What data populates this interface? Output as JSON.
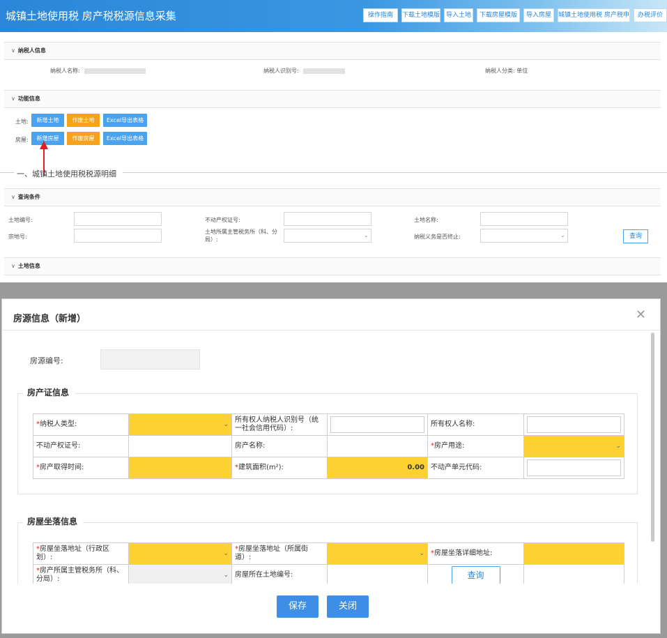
{
  "header": {
    "title": "城镇土地使用税 房产税税源信息采集",
    "buttons": [
      "操作指南",
      "下载土地模版",
      "导入土地",
      "下载房屋模版",
      "导入房屋",
      "城镇土地使用税 房产税申报",
      "办税评价"
    ]
  },
  "taxpayer": {
    "section_title": "纳税人信息",
    "name_label": "纳税人名称:",
    "id_label": "纳税人识别号:",
    "category_label": "纳税人分类:",
    "category_value": "单位"
  },
  "functions": {
    "section_title": "功能信息",
    "land_label": "土地:",
    "house_label": "房屋:",
    "land_buttons": [
      "新增土地",
      "作废土地",
      "Excel导出表格"
    ],
    "house_buttons": [
      "新增房屋",
      "作废房屋",
      "Excel导出表格"
    ]
  },
  "divider_title": "一、城镇土地使用税税源明细",
  "query": {
    "section_title": "查询条件",
    "land_no": "土地编号:",
    "cert_no": "不动产权证号:",
    "land_name": "土地名称:",
    "parcel_no": "宗地号:",
    "tax_office": "土地所属主管税务所（科、分局）:",
    "terminated": "纳税义务是否终止:",
    "query_button": "查询"
  },
  "land_info": {
    "section_title": "土地信息"
  },
  "modal": {
    "title": "房源信息（新增）",
    "source_no_label": "房源编号:",
    "cert_section": "房产证信息",
    "cert_rows": [
      [
        "纳税人类型:",
        "所有权人纳税人识别号（统一社会信用代码）:",
        "所有权人名称:"
      ],
      [
        "不动产权证号:",
        "房产名称:",
        "房产用途:"
      ],
      [
        "房产取得时间:",
        "建筑面积(m²):",
        "不动产单元代码:"
      ]
    ],
    "area_value": "0.00",
    "location_section": "房屋坐落信息",
    "loc_rows": [
      [
        "房屋坐落地址（行政区划）:",
        "房屋坐落地址（所属街道）:",
        "房屋坐落详细地址:"
      ],
      [
        "房产所属主管税务所（科、分局）:",
        "房屋所在土地编号:"
      ]
    ],
    "loc_query_button": "查询",
    "save_button": "保存",
    "close_button": "关闭"
  },
  "colors": {
    "header_blue": "#2a86d8",
    "button_blue": "#4aa3ec",
    "button_orange": "#f5a21c",
    "required_yellow": "#fdd132",
    "required_red": "#e02020"
  }
}
